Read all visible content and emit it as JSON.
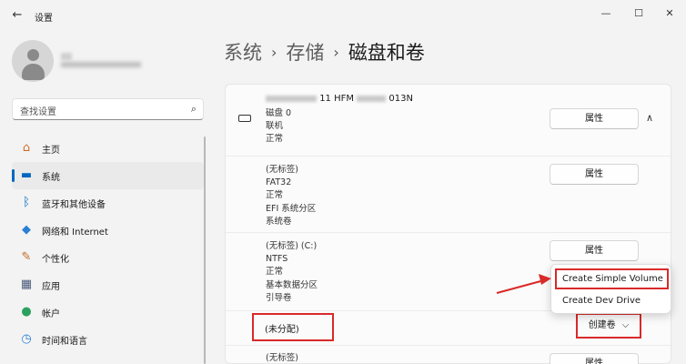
{
  "window": {
    "back_icon": "←",
    "title": "设置",
    "minimize": "—",
    "maximize": "☐",
    "close": "✕"
  },
  "search": {
    "placeholder": "查找设置",
    "icon": "⌕"
  },
  "nav": [
    {
      "label": "主页",
      "icon": "home-icon",
      "glyph": "⌂",
      "color": "#d06a2a"
    },
    {
      "label": "系统",
      "icon": "monitor-icon",
      "glyph": "▬",
      "color": "#0067c0",
      "active": true
    },
    {
      "label": "蓝牙和其他设备",
      "icon": "bluetooth-icon",
      "glyph": "ᛒ",
      "color": "#0067c0"
    },
    {
      "label": "网络和 Internet",
      "icon": "wifi-icon",
      "glyph": "◆",
      "color": "#2b7fd6"
    },
    {
      "label": "个性化",
      "icon": "brush-icon",
      "glyph": "✎",
      "color": "#c06a2a"
    },
    {
      "label": "应用",
      "icon": "apps-icon",
      "glyph": "▦",
      "color": "#4a5a7a"
    },
    {
      "label": "帐户",
      "icon": "account-icon",
      "glyph": "●",
      "color": "#2aa160"
    },
    {
      "label": "时间和语言",
      "icon": "globe-clock-icon",
      "glyph": "◷",
      "color": "#2b7fd6"
    }
  ],
  "breadcrumb": {
    "level1": "系统",
    "level2": "存储",
    "current": "磁盘和卷",
    "separator": "›"
  },
  "disk": {
    "name_prefix": "11 HFM",
    "name_suffix": "013N",
    "lines": [
      "磁盘 0",
      "联机",
      "正常"
    ],
    "properties_label": "属性",
    "chevron": "∧"
  },
  "volumes": [
    {
      "lines": [
        "(无标签)",
        "FAT32",
        "正常",
        "EFI 系统分区",
        "系统卷"
      ],
      "properties_label": "属性"
    },
    {
      "lines": [
        "(无标签) (C:)",
        "NTFS",
        "正常",
        "基本数据分区",
        "引导卷"
      ],
      "properties_label": "属性"
    },
    {
      "lines": [
        "(无标签)"
      ],
      "properties_label": "属性"
    }
  ],
  "unallocated": {
    "label": "(未分配)",
    "create_label": "创建卷",
    "chevron": "⌵"
  },
  "context_menu": {
    "items": [
      "Create Simple Volume",
      "Create Dev Drive"
    ]
  },
  "colors": {
    "accent": "#0067c0",
    "highlight": "#d92a2a"
  }
}
